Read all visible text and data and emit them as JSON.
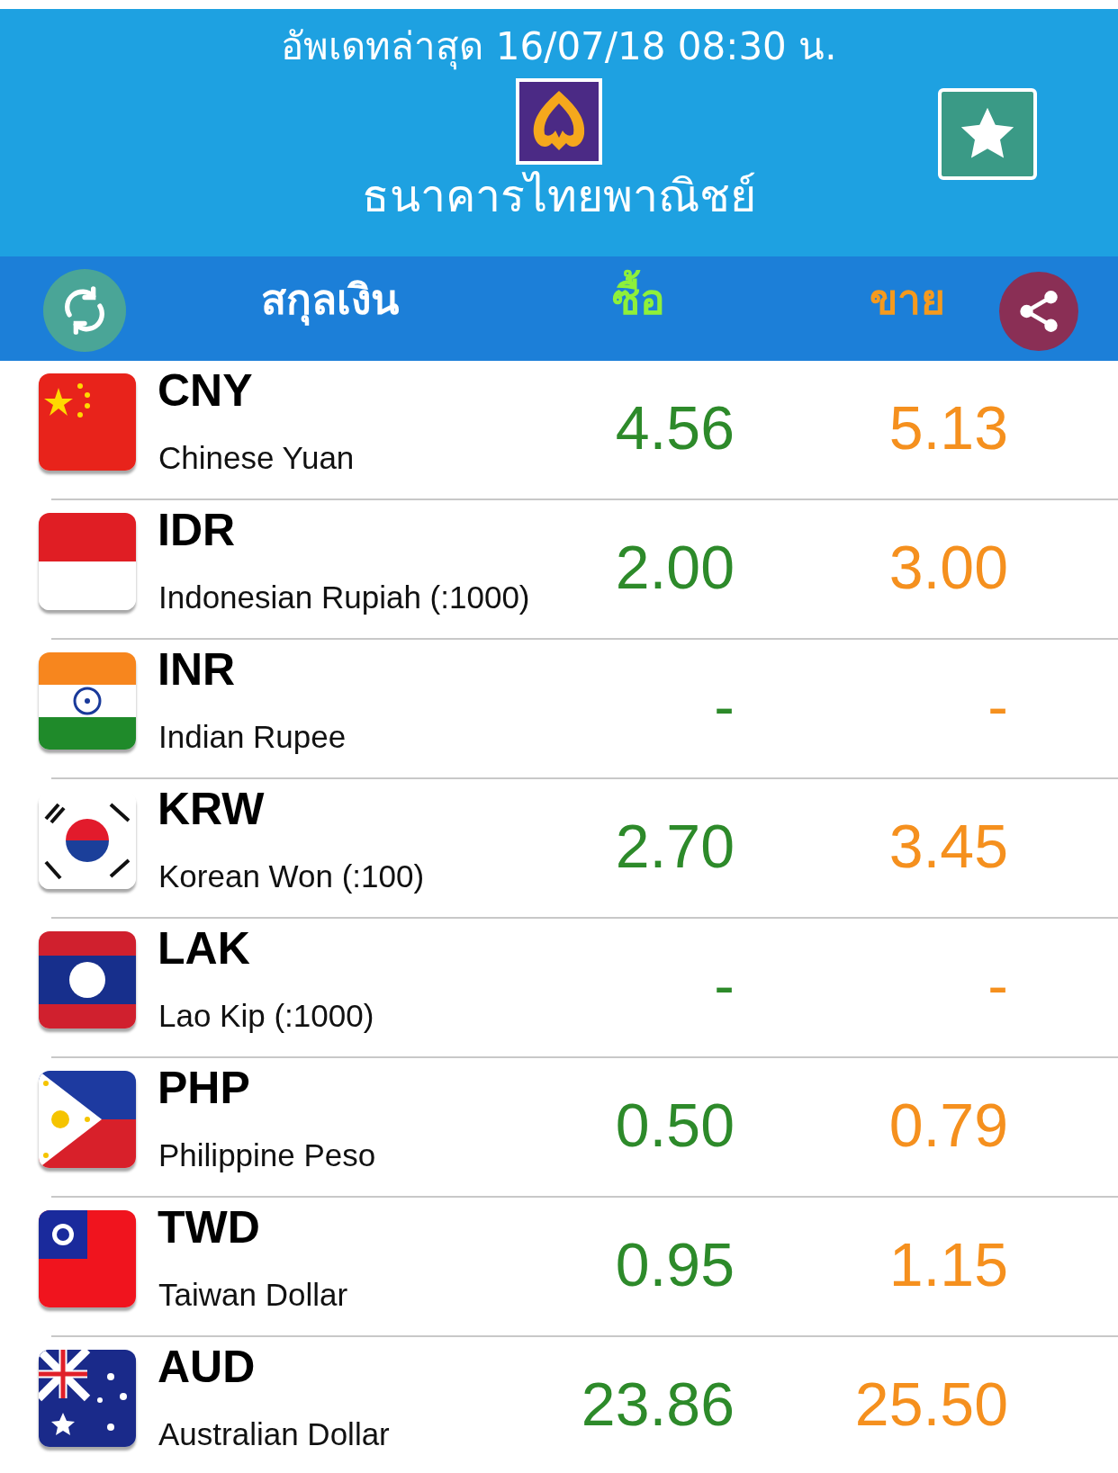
{
  "header": {
    "updated": "อัพเดทล่าสุด 16/07/18 08:30 น.",
    "bank_name": "ธนาคารไทยพาณิชย์"
  },
  "toolbar": {
    "currency": "สกุลเงิน",
    "buy": "ซื้อ",
    "sell": "ขาย"
  },
  "rates": [
    {
      "code": "CNY",
      "name": "Chinese Yuan",
      "buy": "4.56",
      "sell": "5.13"
    },
    {
      "code": "IDR",
      "name": "Indonesian Rupiah (:1000)",
      "buy": "2.00",
      "sell": "3.00"
    },
    {
      "code": "INR",
      "name": "Indian Rupee",
      "buy": "-",
      "sell": "-"
    },
    {
      "code": "KRW",
      "name": "Korean Won (:100)",
      "buy": "2.70",
      "sell": "3.45"
    },
    {
      "code": "LAK",
      "name": "Lao Kip (:1000)",
      "buy": "-",
      "sell": "-"
    },
    {
      "code": "PHP",
      "name": "Philippine Peso",
      "buy": "0.50",
      "sell": "0.79"
    },
    {
      "code": "TWD",
      "name": "Taiwan Dollar",
      "buy": "0.95",
      "sell": "1.15"
    },
    {
      "code": "AUD",
      "name": "Australian Dollar",
      "buy": "23.86",
      "sell": "25.50"
    }
  ]
}
